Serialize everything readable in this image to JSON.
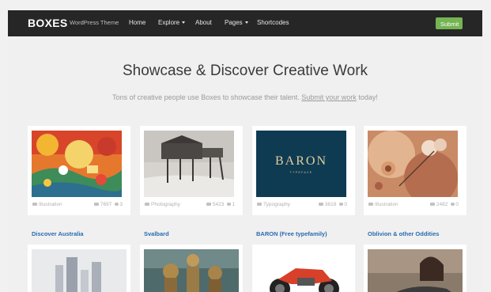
{
  "navbar": {
    "brand": "BOXES",
    "tagline": "WordPress Theme",
    "items": [
      "Home",
      "Explore",
      "About",
      "Pages",
      "Shortcodes"
    ],
    "submit_label": "Submit"
  },
  "hero": {
    "title": "Showcase & Discover Creative Work",
    "subtitle_before": "Tons of creative people use Boxes to showcase their talent. ",
    "subtitle_link": "Submit your work",
    "subtitle_after": " today!"
  },
  "cards": [
    {
      "category": "Illustration",
      "views": "7697",
      "comments": "3",
      "title": "Discover Australia"
    },
    {
      "category": "Photography",
      "views": "5423",
      "comments": "1",
      "title": "Svalbard"
    },
    {
      "category": "Typography",
      "views": "3618",
      "comments": "0",
      "title": "BARON (Free typefamily)"
    },
    {
      "category": "Illustration",
      "views": "2482",
      "comments": "0",
      "title": "Oblivion & other Oddities"
    }
  ],
  "baron_logo": {
    "word": "BARON",
    "sub": "TYPEFACE"
  },
  "colors": {
    "navbar": "#262626",
    "accent": "#74b452",
    "link": "#2a6bb0",
    "page_bg": "#f0f0f0"
  }
}
